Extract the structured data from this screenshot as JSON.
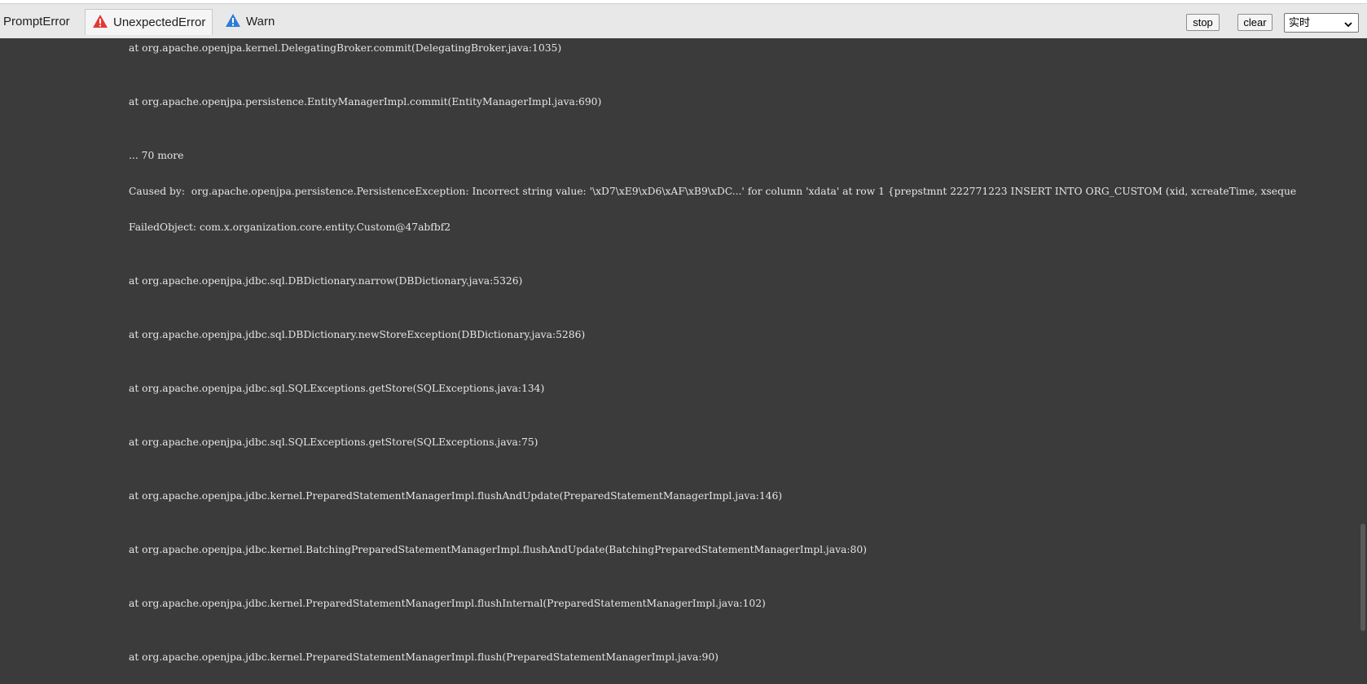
{
  "tabs": [
    {
      "label": "PromptError",
      "icon": ""
    },
    {
      "label": "UnexpectedError",
      "icon": "error-triangle-icon",
      "icon_color": "#e53935"
    },
    {
      "label": "Warn",
      "icon": "warning-triangle-icon",
      "icon_color": "#2f7dd3"
    }
  ],
  "toolbar": {
    "stop_label": "stop",
    "clear_label": "clear",
    "mode_selected": "实时"
  },
  "colors": {
    "toolbar_bg": "#e8e8e8",
    "console_bg": "#3b3b3b",
    "console_text": "#e6e6e6"
  },
  "log_lines": [
    "at org.apache.openjpa.kernel.DelegatingBroker.commit(DelegatingBroker.java:1035)",
    "at org.apache.openjpa.persistence.EntityManagerImpl.commit(EntityManagerImpl.java:690)",
    "... 70 more",
    "Caused by:  org.apache.openjpa.persistence.PersistenceException: Incorrect string value: '\\xD7\\xE9\\xD6\\xAF\\xB9\\xDC...' for column 'xdata' at row 1 {prepstmnt 222771223 INSERT INTO ORG_CUSTOM (xid, xcreateTime, xseque",
    "FailedObject: com.x.organization.core.entity.Custom@47abfbf2",
    "at org.apache.openjpa.jdbc.sql.DBDictionary.narrow(DBDictionary.java:5326)",
    "at org.apache.openjpa.jdbc.sql.DBDictionary.newStoreException(DBDictionary.java:5286)",
    "at org.apache.openjpa.jdbc.sql.SQLExceptions.getStore(SQLExceptions.java:134)",
    "at org.apache.openjpa.jdbc.sql.SQLExceptions.getStore(SQLExceptions.java:75)",
    "at org.apache.openjpa.jdbc.kernel.PreparedStatementManagerImpl.flushAndUpdate(PreparedStatementManagerImpl.java:146)",
    "at org.apache.openjpa.jdbc.kernel.BatchingPreparedStatementManagerImpl.flushAndUpdate(BatchingPreparedStatementManagerImpl.java:80)",
    "at org.apache.openjpa.jdbc.kernel.PreparedStatementManagerImpl.flushInternal(PreparedStatementManagerImpl.java:102)",
    "at org.apache.openjpa.jdbc.kernel.PreparedStatementManagerImpl.flush(PreparedStatementManagerImpl.java:90)"
  ]
}
